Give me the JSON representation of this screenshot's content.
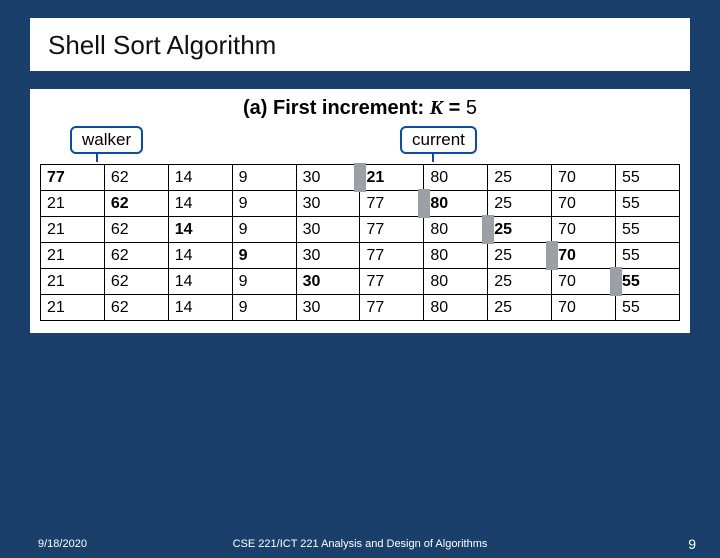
{
  "title": "Shell Sort Algorithm",
  "caption": {
    "prefix": "(a) ",
    "bold": "First increment: ",
    "kvar": "K",
    "eq": " = ",
    "kval": "5"
  },
  "labels": {
    "walker": "walker",
    "current": "current"
  },
  "rows": [
    {
      "cells": [
        "77",
        "62",
        "14",
        "9",
        "30",
        "21",
        "80",
        "25",
        "70",
        "55"
      ],
      "bold": [
        0,
        5
      ],
      "marker_after": 4
    },
    {
      "cells": [
        "21",
        "62",
        "14",
        "9",
        "30",
        "77",
        "80",
        "25",
        "70",
        "55"
      ],
      "bold": [
        1,
        6
      ],
      "marker_after": 5
    },
    {
      "cells": [
        "21",
        "62",
        "14",
        "9",
        "30",
        "77",
        "80",
        "25",
        "70",
        "55"
      ],
      "bold": [
        2,
        7
      ],
      "marker_after": 6
    },
    {
      "cells": [
        "21",
        "62",
        "14",
        "9",
        "30",
        "77",
        "80",
        "25",
        "70",
        "55"
      ],
      "bold": [
        3,
        8
      ],
      "marker_after": 7
    },
    {
      "cells": [
        "21",
        "62",
        "14",
        "9",
        "30",
        "77",
        "80",
        "25",
        "70",
        "55"
      ],
      "bold": [
        4,
        9
      ],
      "marker_after": 8
    },
    {
      "cells": [
        "21",
        "62",
        "14",
        "9",
        "30",
        "77",
        "80",
        "25",
        "70",
        "55"
      ],
      "bold": [],
      "marker_after": null
    }
  ],
  "footer": {
    "date": "9/18/2020",
    "course": "CSE 221/ICT 221 Analysis and Design of Algorithms",
    "page": "9"
  }
}
